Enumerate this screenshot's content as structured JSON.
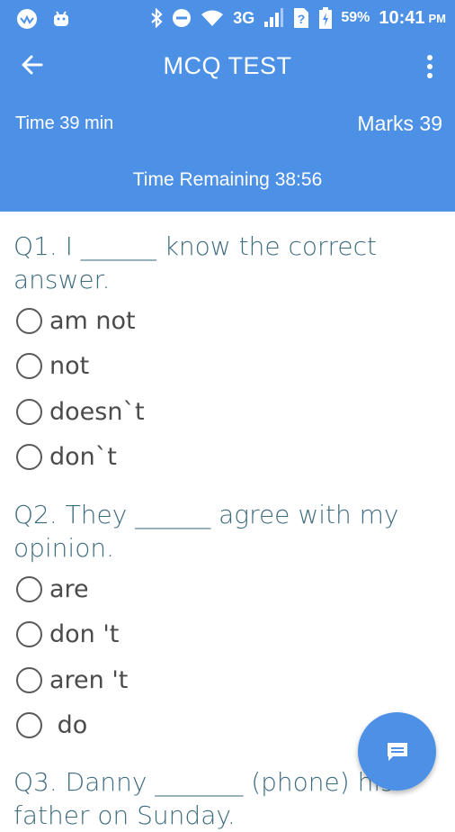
{
  "status_bar": {
    "network": "3G",
    "battery": "59%",
    "time": "10:41",
    "ampm": "PM",
    "icons": [
      "app-icon",
      "android-icon",
      "bluetooth-icon",
      "dnd-icon",
      "wifi-icon",
      "signal-icon",
      "no-sim-icon",
      "battery-icon"
    ]
  },
  "header": {
    "title": "MCQ TEST",
    "time": "Time 39 min",
    "marks": "Marks 39",
    "remaining": "Time Remaining 38:56"
  },
  "questions": [
    {
      "text": "Q1.  I ______ know the correct answer.",
      "options": [
        "am not",
        "not",
        "doesn`t",
        "don`t"
      ]
    },
    {
      "text": "Q2.  They ______ agree with my opinion.",
      "options": [
        "are",
        "don 't",
        "aren 't",
        " do"
      ]
    },
    {
      "text": "Q3. Danny _______ (phone) his father on Sunday.",
      "options": []
    }
  ],
  "colors": {
    "primary": "#4d91e6",
    "question": "#3e6c7f",
    "option": "#4b4b4b"
  }
}
